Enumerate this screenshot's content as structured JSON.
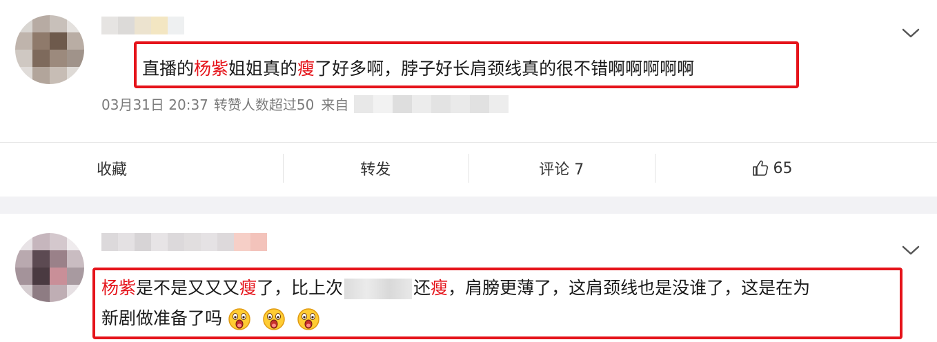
{
  "colors": {
    "highlight": "#e5131a",
    "meta": "#7b7b7b",
    "text": "#1a1a1a"
  },
  "post1": {
    "content": {
      "p1": "直播的",
      "r1": "杨紫",
      "p2": "姐姐真的",
      "r2": "瘦",
      "p3": "了好多啊，脖子好长肩颈线真的很不错啊啊啊啊啊"
    },
    "meta": {
      "date": "03月31日 20:37",
      "reposts": "转赞人数超过50",
      "source_label": "来自"
    },
    "actions": {
      "favorite": "收藏",
      "repost": "转发",
      "comment": "评论 7",
      "like_count": "65"
    },
    "icons": {
      "menu": "chevron-down-icon",
      "like": "thumbs-up-icon"
    }
  },
  "post2": {
    "content": {
      "r1": "杨紫",
      "p1": "是不是又又又",
      "r2": "瘦",
      "p2": "了，比上次",
      "p3": "还",
      "r3": "瘦",
      "p4": "，肩膀更薄了，这肩颈线也是没谁了，这是在为",
      "p5": "新剧做准备了吗"
    },
    "emojis": [
      "shocked-emoji",
      "shocked-emoji",
      "shocked-emoji"
    ],
    "icons": {
      "menu": "chevron-down-icon"
    }
  }
}
